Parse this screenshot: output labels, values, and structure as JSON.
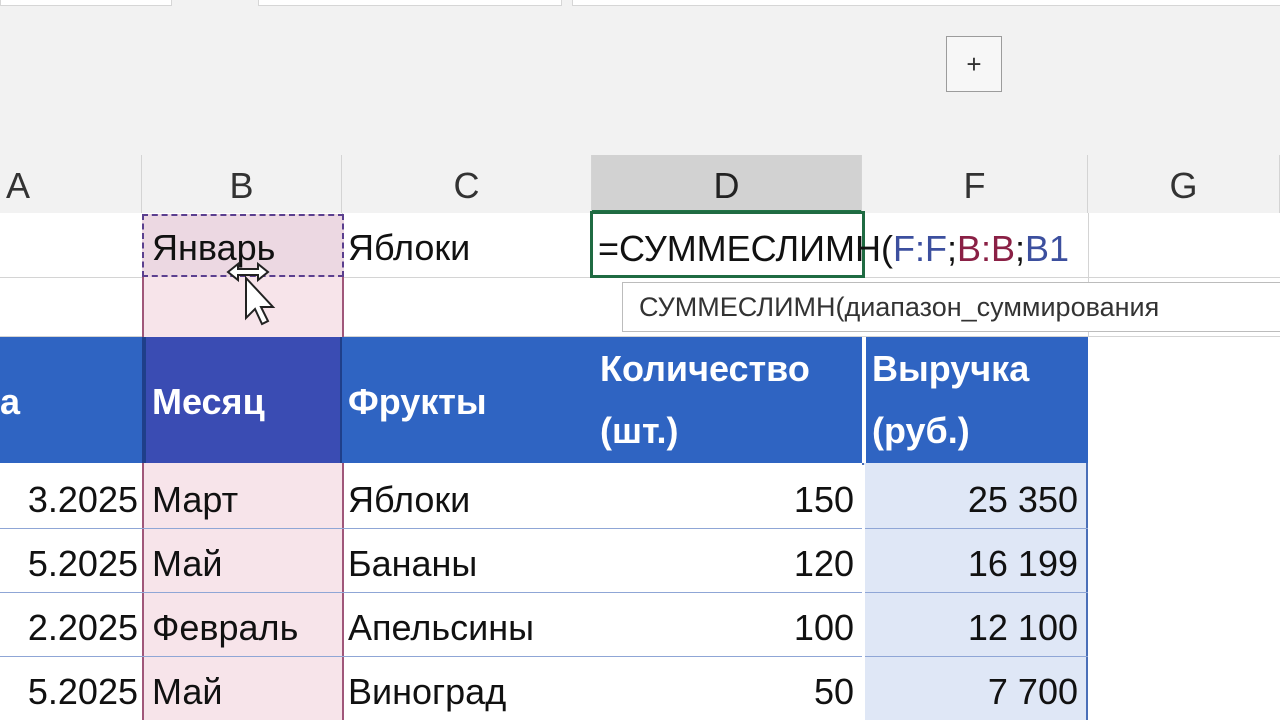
{
  "toolbar": {
    "add_button_label": "+"
  },
  "columns": [
    "A",
    "B",
    "C",
    "D",
    "F",
    "G"
  ],
  "row1": {
    "b": "Январь",
    "c": "Яблоки",
    "formula": {
      "prefix": "=СУММЕСЛИМН(",
      "ref1": "F:F",
      "sep1": ";",
      "ref2": "B:B",
      "sep2": ";",
      "ref3": "B1"
    }
  },
  "tooltip": "СУММЕСЛИМН(диапазон_суммирования",
  "table": {
    "headers": {
      "a_partial": "а",
      "month": "Месяц",
      "fruit": "Фрукты",
      "qty_line1": "Количество",
      "qty_line2": "(шт.)",
      "rev_line1": "Выручка",
      "rev_line2": "(руб.)"
    },
    "rows": [
      {
        "date": "3.2025",
        "month": "Март",
        "fruit": "Яблоки",
        "qty": "150",
        "revenue": "25 350"
      },
      {
        "date": "5.2025",
        "month": "Май",
        "fruit": "Бананы",
        "qty": "120",
        "revenue": "16 199"
      },
      {
        "date": "2.2025",
        "month": "Февраль",
        "fruit": "Апельсины",
        "qty": "100",
        "revenue": "12 100"
      },
      {
        "date": "5.2025",
        "month": "Май",
        "fruit": "Виноград",
        "qty": "50",
        "revenue": "7 700"
      }
    ]
  },
  "colors": {
    "header_blue": "#2f64c2",
    "month_header": "#3a4cb3",
    "active_cell_border": "#1f6b42",
    "range_b": "#8a2045",
    "range_f": "#3c4f9e"
  },
  "icons": {
    "cursor": "move-cursor-icon"
  }
}
